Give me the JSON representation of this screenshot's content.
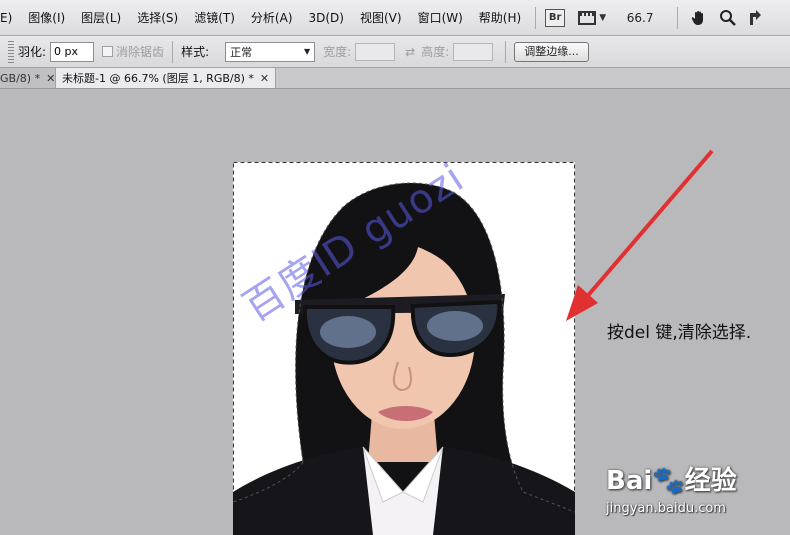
{
  "menu": {
    "items": [
      "E)",
      "图像(I)",
      "图层(L)",
      "选择(S)",
      "滤镜(T)",
      "分析(A)",
      "3D(D)",
      "视图(V)",
      "窗口(W)",
      "帮助(H)"
    ],
    "br_label": "Br",
    "zoom": "66.7",
    "icons": [
      "bridge-icon",
      "screen-mode-icon",
      "hand-icon",
      "zoom-icon",
      "rotate-icon"
    ]
  },
  "options": {
    "feather_label": "羽化:",
    "feather_value": "0 px",
    "antialias_label": "消除锯齿",
    "style_label": "样式:",
    "style_value": "正常",
    "width_label": "宽度:",
    "height_label": "高度:",
    "refine_edge_button": "调整边缘..."
  },
  "tabs": [
    {
      "label": "GB/8) *",
      "active": false
    },
    {
      "label": "未标题-1 @ 66.7% (图层 1, RGB/8) *",
      "active": true
    }
  ],
  "canvas": {
    "watermark": "百度ID guozi",
    "annotation": "按del 键,清除选择.",
    "baidu_logo": "Bai🐾经验",
    "baidu_url": "jingyan.baidu.com",
    "colors": {
      "arrow": "#e03030",
      "watermark": "#5a5ae6",
      "background": "#b9b8bb"
    }
  }
}
